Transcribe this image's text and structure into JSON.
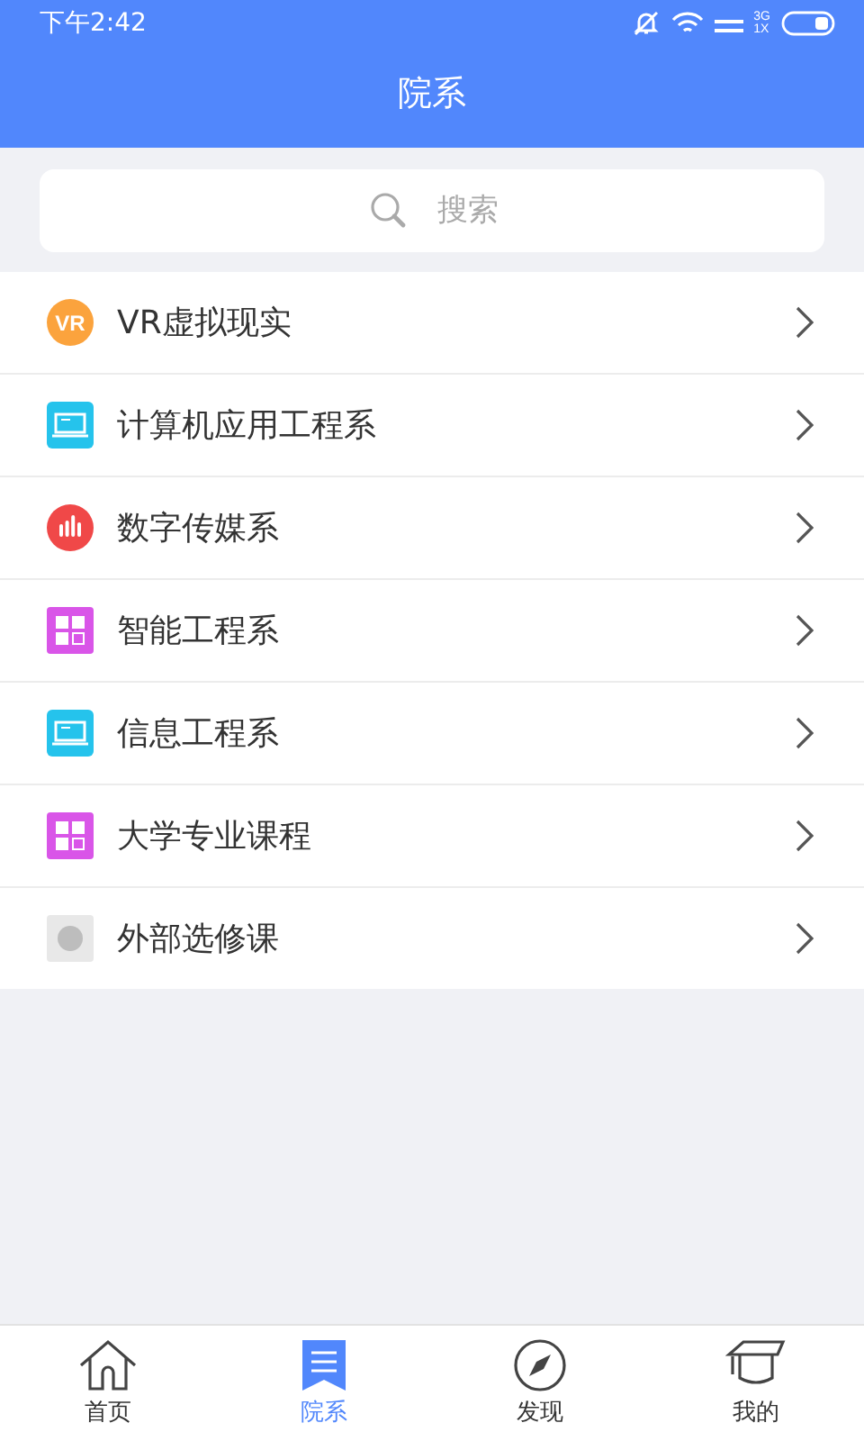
{
  "status_bar": {
    "time": "下午2:42",
    "network_top": "3G",
    "network_bottom": "1X"
  },
  "header": {
    "title": "院系"
  },
  "search": {
    "placeholder": "搜索"
  },
  "departments": [
    {
      "name": "VR虚拟现实",
      "kind": "vr",
      "icon_text": "VR"
    },
    {
      "name": "计算机应用工程系",
      "kind": "laptop"
    },
    {
      "name": "数字传媒系",
      "kind": "bars"
    },
    {
      "name": "智能工程系",
      "kind": "grid"
    },
    {
      "name": "信息工程系",
      "kind": "laptop"
    },
    {
      "name": "大学专业课程",
      "kind": "grid"
    },
    {
      "name": "外部选修课",
      "kind": "coin"
    }
  ],
  "tab_bar": [
    {
      "label": "首页",
      "kind": "home",
      "selected": false
    },
    {
      "label": "院系",
      "kind": "list",
      "selected": true
    },
    {
      "label": "发现",
      "kind": "compass",
      "selected": false
    },
    {
      "label": "我的",
      "kind": "cap",
      "selected": false
    }
  ]
}
